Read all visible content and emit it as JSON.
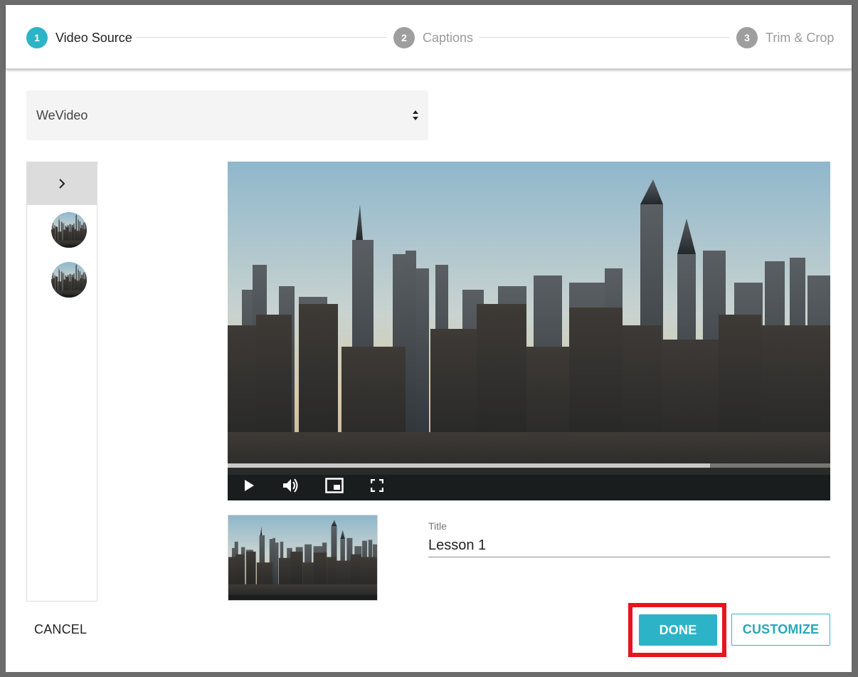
{
  "stepper": {
    "steps": [
      {
        "number": "1",
        "label": "Video Source",
        "active": true
      },
      {
        "number": "2",
        "label": "Captions",
        "active": false
      },
      {
        "number": "3",
        "label": "Trim & Crop",
        "active": false
      }
    ]
  },
  "source": {
    "selected": "WeVideo"
  },
  "side_panel": {
    "toggle_icon": "chevron-right-icon",
    "thumbnails": [
      "video-thumbnail-avatar",
      "video-thumbnail-avatar"
    ]
  },
  "player": {
    "progress_fraction": 0.8,
    "controls": [
      "play-icon",
      "volume-icon",
      "picture-in-picture-icon",
      "fullscreen-icon"
    ]
  },
  "title_field": {
    "label": "Title",
    "value": "Lesson 1"
  },
  "actions": {
    "cancel_label": "CANCEL",
    "done_label": "DONE",
    "customize_label": "CUSTOMIZE"
  },
  "colors": {
    "accent": "#2db3c8",
    "highlight": "#e8141e",
    "inactive_step": "#9e9e9e"
  }
}
